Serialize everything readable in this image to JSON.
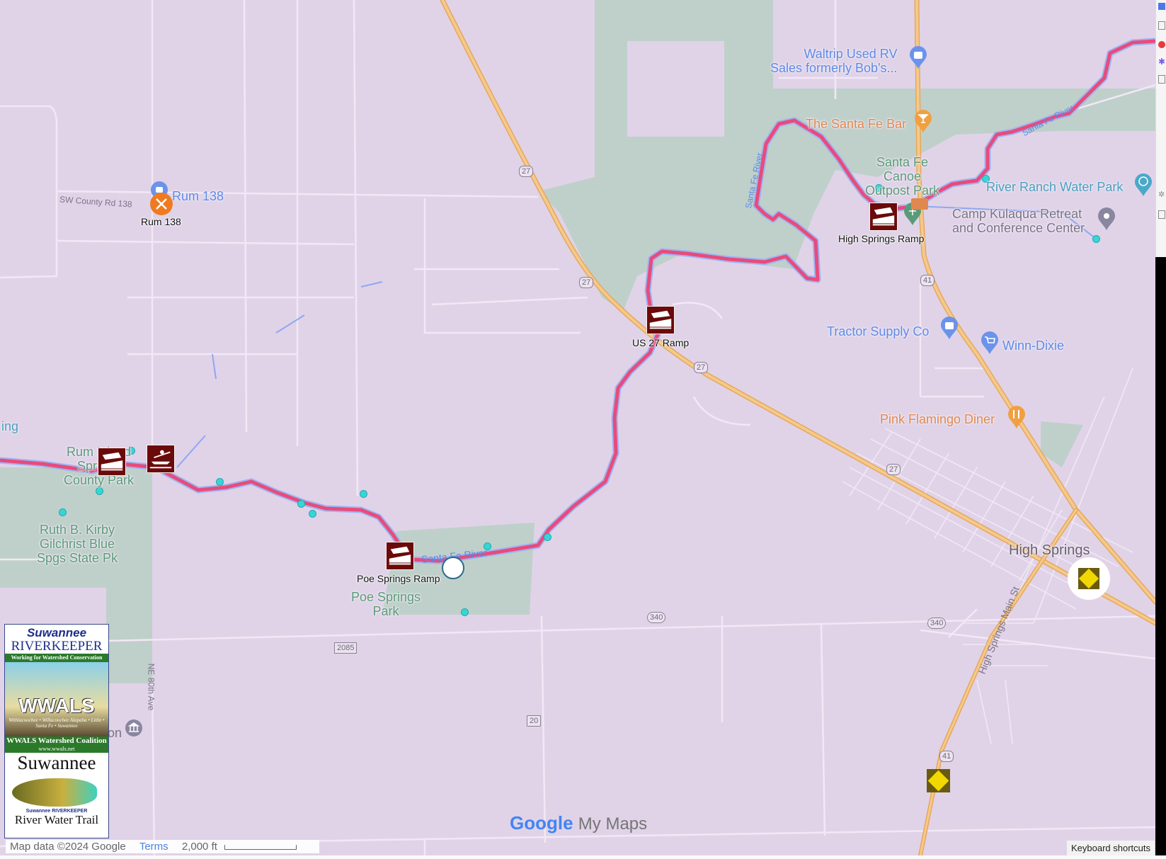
{
  "map": {
    "colors": {
      "land": "#e0d3e8",
      "park": "#bfd0ca",
      "river_route": "#e84b7c",
      "water": "#8ea8f0",
      "highway": "#f0b86a",
      "ramp_marker": "#6b0a0a"
    },
    "route_markers": [
      {
        "name": "Rum 138",
        "icon": "paddle-icon"
      },
      {
        "name": "High Springs Ramp",
        "icon": "boat-ramp-icon"
      },
      {
        "name": "US 27 Ramp",
        "icon": "boat-ramp-icon"
      },
      {
        "name": "Poe Springs Ramp",
        "icon": "boat-ramp-icon"
      },
      {
        "name": "",
        "icon": "boat-ramp-icon"
      },
      {
        "name": "",
        "icon": "kayak-icon"
      }
    ],
    "places": {
      "waltrip": [
        "Waltrip Used RV",
        "Sales formerly Bob's..."
      ],
      "santa_fe_bar": "The Santa Fe Bar",
      "canoe_outpost": [
        "Santa Fe",
        "Canoe",
        "Outpost Park"
      ],
      "river_ranch": "River Ranch Water Park",
      "camp_kulaqua": [
        "Camp Kulaqua Retreat",
        "and Conference Center"
      ],
      "tractor_supply": "Tractor Supply Co",
      "winn_dixie": "Winn-Dixie",
      "pink_flamingo": "Pink Flamingo Diner",
      "high_springs": "High Springs",
      "rum_138_place": "Rum 138",
      "rum_island": [
        "Rum Island",
        "Springs",
        "County Park"
      ],
      "ruth_kirby": [
        "Ruth B. Kirby",
        "Gilchrist Blue",
        "Spgs State Pk"
      ],
      "poe_springs_park": [
        "Poe Springs",
        "Park"
      ],
      "partial_left": "ing",
      "partial_left2": "on"
    },
    "roads": {
      "county_rd_138": "SW County Rd 138",
      "ne_80th": "NE 80th Ave",
      "main_st": "High Springs Main St",
      "santa_fe_river": "Santa Fe River",
      "shields": [
        "27",
        "27",
        "27",
        "27",
        "41",
        "41",
        "340",
        "340",
        "2085",
        "20"
      ]
    },
    "logo": {
      "line1": "Suwannee",
      "line2": "RIVERKEEPER",
      "tagline": "Working for Watershed Conservation",
      "wwals": "WWALS",
      "rivers": "Withlacoochee • Willacoochee Alapaha • Little • Santa Fe • Suwannee",
      "coalition": "WWALS Watershed Coalition",
      "url": "www.wwals.net",
      "trail1": "Suwannee",
      "trail_keeper": "Suwannee RIVERKEEPER",
      "trail2": "River Water Trail"
    },
    "footer": {
      "attribution": "Map data ©2024 Google",
      "terms": "Terms",
      "scale": "2,000 ft",
      "keyboard": "Keyboard shortcuts",
      "brand_google": "Google",
      "brand_mymaps": "My Maps"
    }
  }
}
